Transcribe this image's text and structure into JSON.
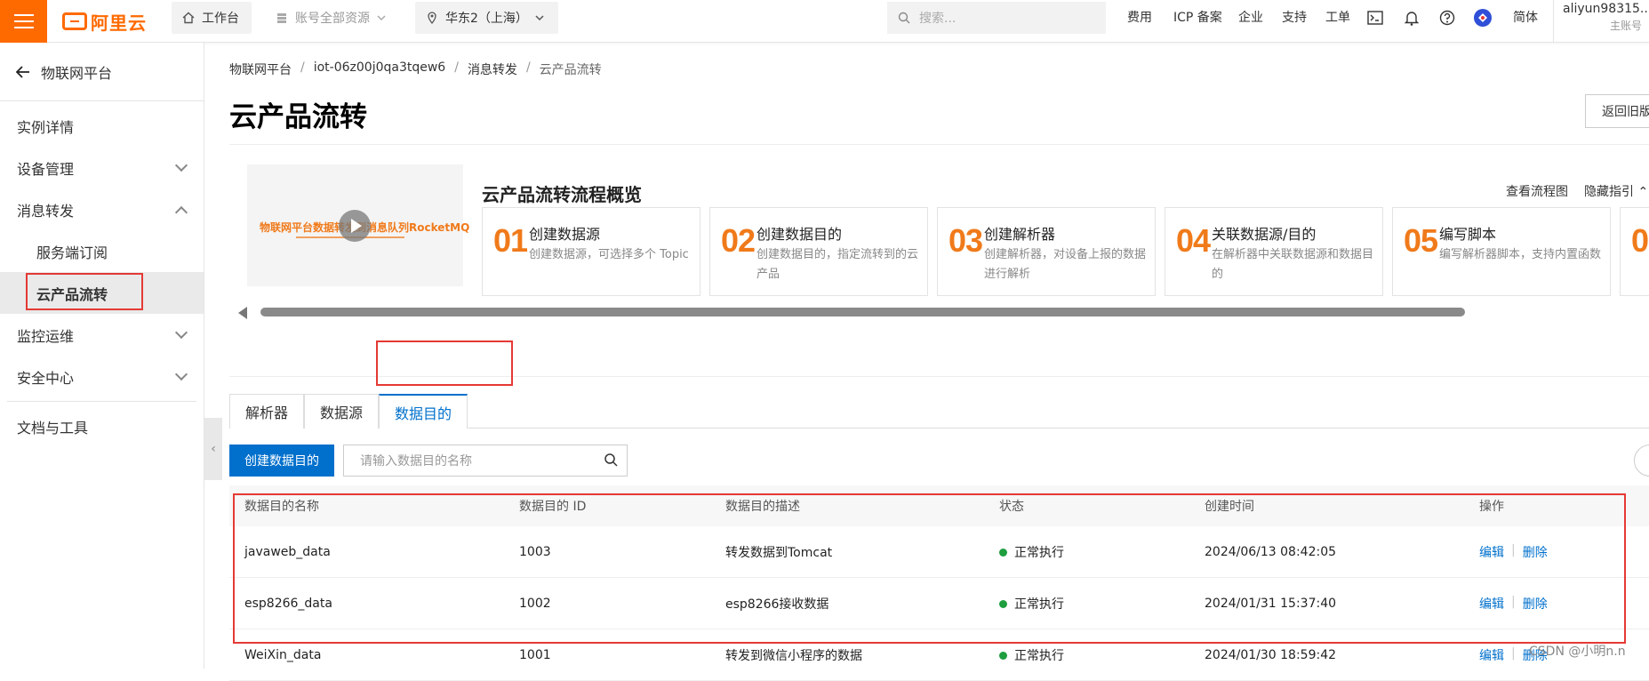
{
  "topbar": {
    "logo": "阿里云",
    "workbench": "工作台",
    "account_resources": "账号全部资源",
    "region": "华东2（上海）",
    "search_placeholder": "搜索...",
    "links": [
      "费用",
      "ICP 备案",
      "企业",
      "支持",
      "工单"
    ],
    "lang": "简体",
    "user_name": "aliyun98315...",
    "user_role": "主账号"
  },
  "sidebar": {
    "back_label": "物联网平台",
    "items": [
      {
        "label": "实例详情",
        "chevron": "none"
      },
      {
        "label": "设备管理",
        "chevron": "down"
      },
      {
        "label": "消息转发",
        "chevron": "up"
      },
      {
        "label": "服务端订阅",
        "sub": true
      },
      {
        "label": "云产品流转",
        "sub": true,
        "active": true
      },
      {
        "label": "监控运维",
        "chevron": "down"
      },
      {
        "label": "安全中心",
        "chevron": "down"
      },
      {
        "label": "文档与工具",
        "chevron": "none"
      }
    ]
  },
  "breadcrumb": [
    "物联网平台",
    "iot-06z00j0qa3tqew6",
    "消息转发",
    "云产品流转"
  ],
  "page_title": "云产品流转",
  "back_button": "返回旧版",
  "guide": {
    "video_title": "物联网平台数据转发到消息队列RocketMQ",
    "title": "云产品流转流程概览",
    "view_flow": "查看流程图",
    "hide_guide": "隐藏指引",
    "steps": [
      {
        "num": "01",
        "title": "创建数据源",
        "desc": "创建数据源，可选择多个 Topic"
      },
      {
        "num": "02",
        "title": "创建数据目的",
        "desc": "创建数据目的，指定流转到的云产品"
      },
      {
        "num": "03",
        "title": "创建解析器",
        "desc": "创建解析器，对设备上报的数据进行解析"
      },
      {
        "num": "04",
        "title": "关联数据源/目的",
        "desc": "在解析器中关联数据源和数据目的"
      },
      {
        "num": "05",
        "title": "编写脚本",
        "desc": "编写解析器脚本，支持内置函数"
      },
      {
        "num": "0",
        "title": "",
        "desc": ""
      }
    ]
  },
  "tabs": [
    "解析器",
    "数据源",
    "数据目的"
  ],
  "toolbar": {
    "create_button": "创建数据目的",
    "search_placeholder": "请输入数据目的名称"
  },
  "table": {
    "headers": [
      "数据目的名称",
      "数据目的 ID",
      "数据目的描述",
      "状态",
      "创建时间",
      "操作"
    ],
    "rows": [
      {
        "name": "javaweb_data",
        "id": "1003",
        "desc": "转发数据到Tomcat",
        "status": "正常执行",
        "time": "2024/06/13 08:42:05",
        "edit": "编辑",
        "delete": "删除"
      },
      {
        "name": "esp8266_data",
        "id": "1002",
        "desc": "esp8266接收数据",
        "status": "正常执行",
        "time": "2024/01/31 15:37:40",
        "edit": "编辑",
        "delete": "删除"
      },
      {
        "name": "WeiXin_data",
        "id": "1001",
        "desc": "转发到微信小程序的数据",
        "status": "正常执行",
        "time": "2024/01/30 18:59:42",
        "edit": "编辑",
        "delete": "删除"
      }
    ]
  },
  "watermark": "CSDN @小明n.n",
  "colors": {
    "brand": "#ff6a00",
    "primary": "#0070cc",
    "highlight": "#e53935",
    "status_ok": "#1e9e3e",
    "step_num": "#f07a1a"
  }
}
